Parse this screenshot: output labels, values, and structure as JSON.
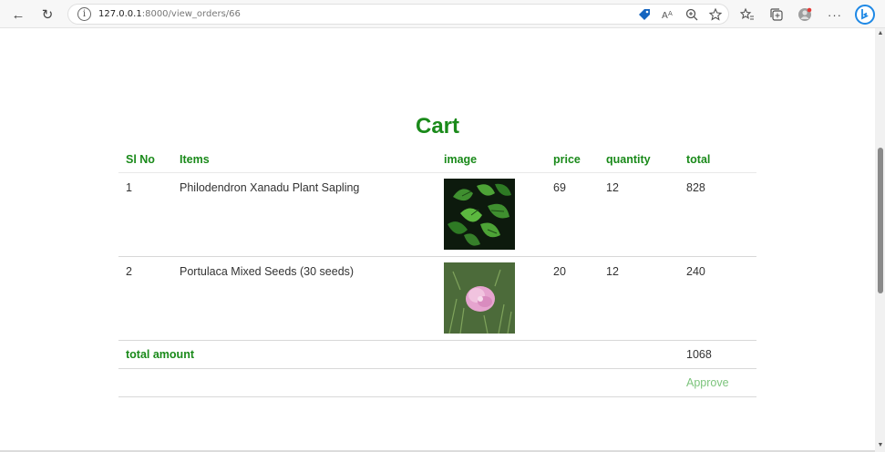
{
  "browser": {
    "url_host": "127.0.0.1",
    "url_path": ":8000/view_orders/66"
  },
  "page": {
    "title": "Cart"
  },
  "table": {
    "headers": {
      "sl_no": "Sl No",
      "items": "Items",
      "image": "image",
      "price": "price",
      "quantity": "quantity",
      "total": "total"
    },
    "rows": [
      {
        "sl_no": "1",
        "item": "Philodendron Xanadu Plant Sapling",
        "price": "69",
        "quantity": "12",
        "total": "828"
      },
      {
        "sl_no": "2",
        "item": "Portulaca Mixed Seeds (30 seeds)",
        "price": "20",
        "quantity": "12",
        "total": "240"
      }
    ],
    "total_label": "total amount",
    "total_value": "1068",
    "approve_label": "Approve"
  },
  "colors": {
    "accent": "#1a8a1a",
    "approve": "#7cc47c"
  }
}
